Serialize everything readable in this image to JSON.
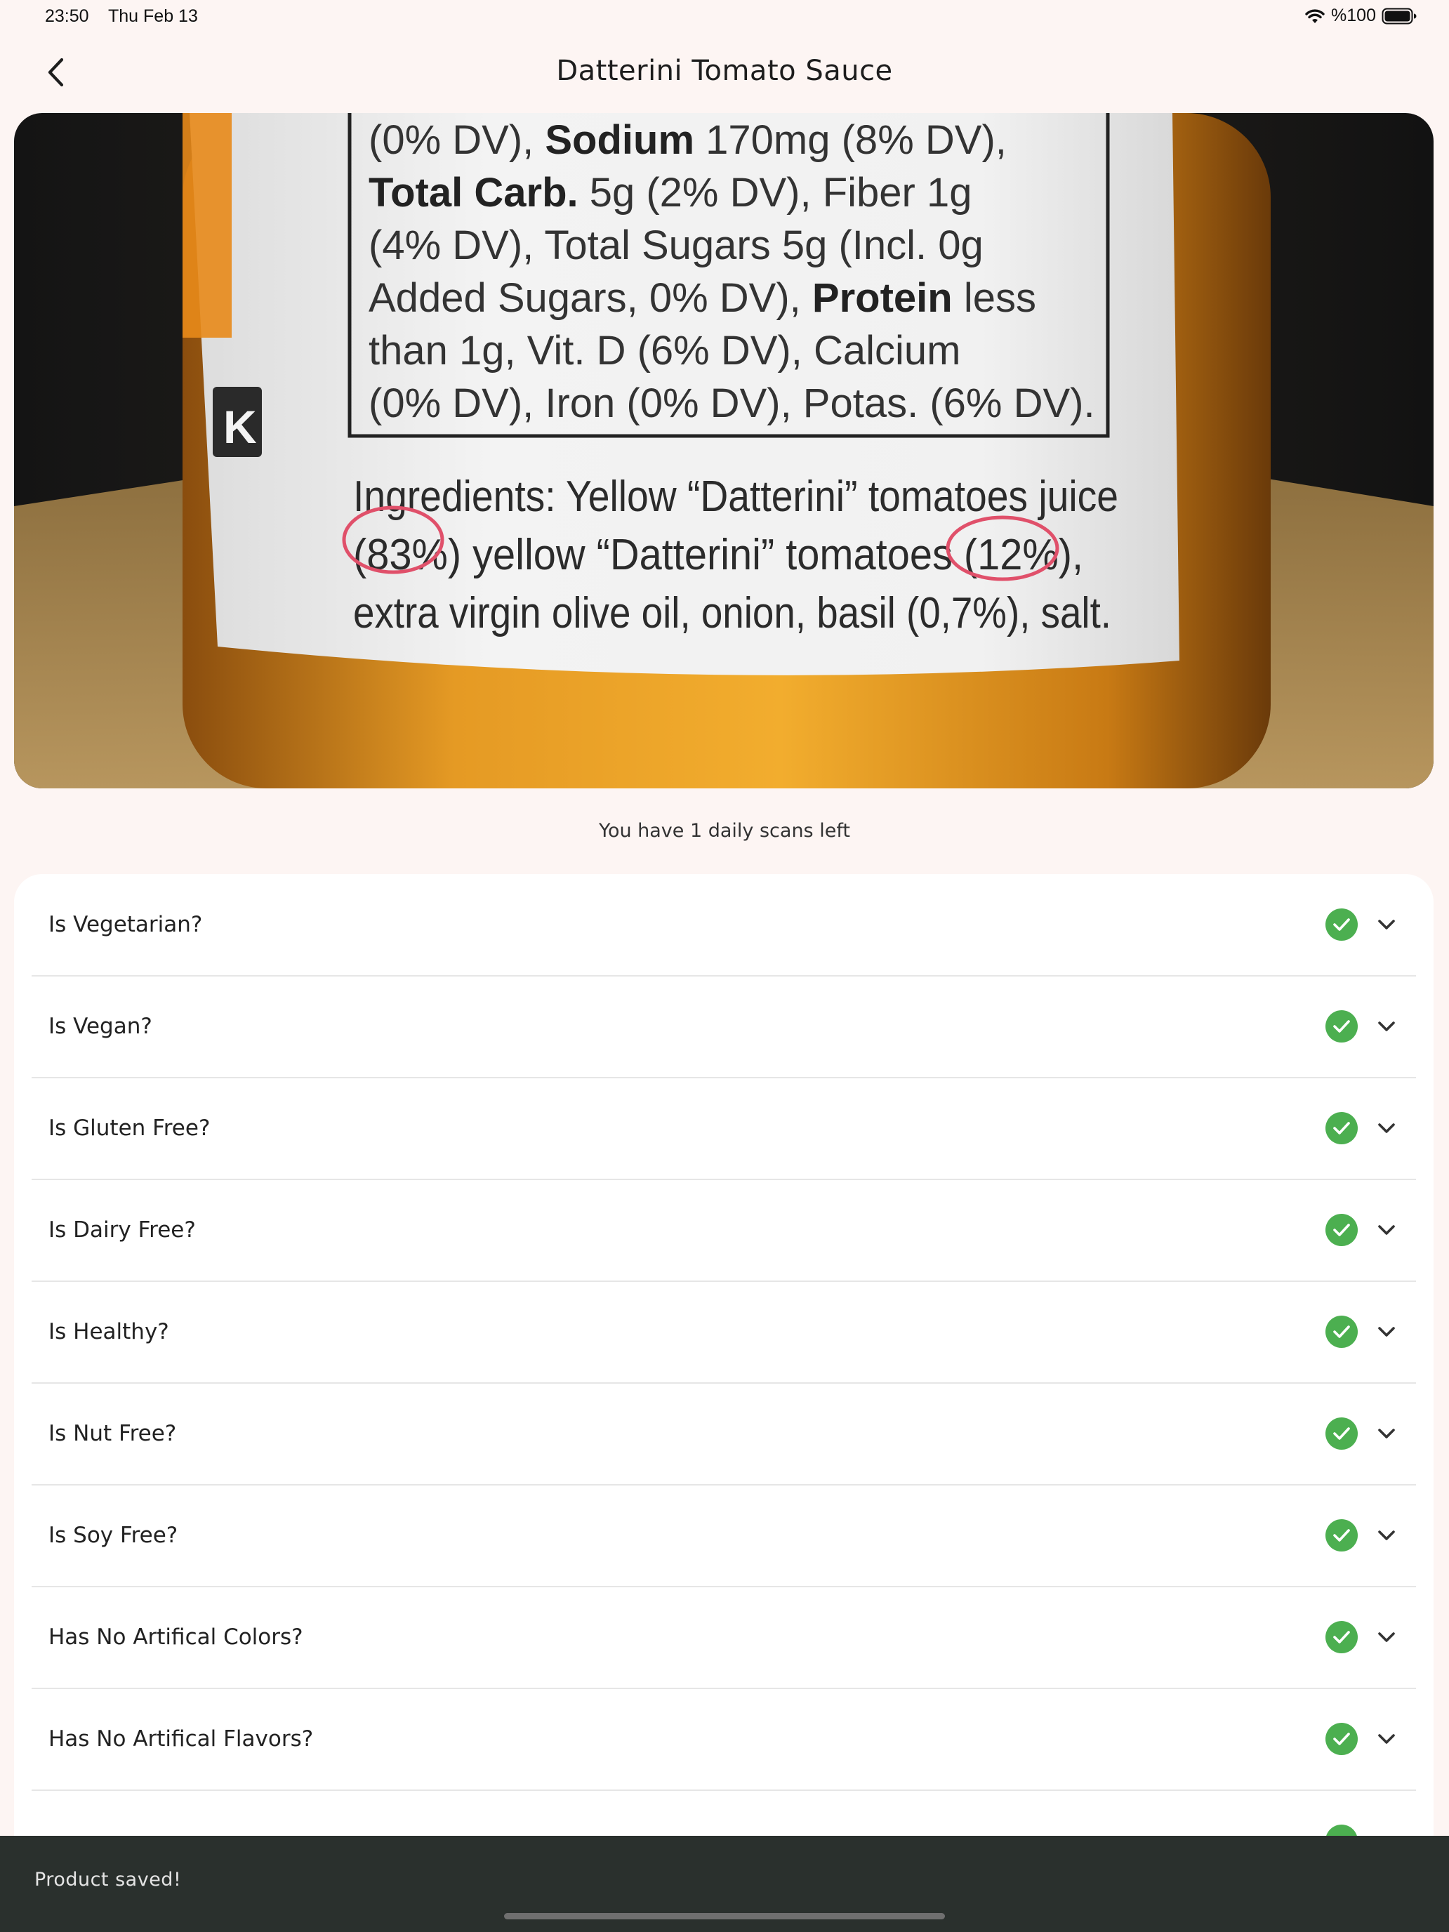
{
  "status_bar": {
    "time": "23:50",
    "date": "Thu Feb 13",
    "battery": "%100"
  },
  "header": {
    "title": "Datterini Tomato Sauce"
  },
  "product_image": {
    "nutrition_lines": [
      [
        "(0% DV), ",
        "Sodium",
        " 170mg (8% DV),"
      ],
      [
        "",
        "Total Carb.",
        " 5g (2% DV), Fiber 1g"
      ],
      [
        "(4% DV), Total Sugars 5g (Incl. 0g",
        "",
        ""
      ],
      [
        "Added Sugars, 0% DV), ",
        "Protein",
        " less"
      ],
      [
        "than 1g, Vit. D (6% DV), Calcium",
        "",
        ""
      ],
      [
        "(0% DV), Iron (0% DV), Potas. (6% DV).",
        "",
        ""
      ]
    ],
    "ingredients_line_1": "Ingredients: Yellow “Datterini” tomatoes juice",
    "ingredients_line_2": "(83%) yellow “Datterini” tomatoes (12%),",
    "ingredients_line_3": "extra virgin olive oil, onion, basil (0,7%), salt.",
    "side_mark": "K"
  },
  "scans_left": "You have 1 daily scans left",
  "checks": [
    {
      "label": "Is Vegetarian?",
      "status": "pass"
    },
    {
      "label": "Is Vegan?",
      "status": "pass"
    },
    {
      "label": "Is Gluten Free?",
      "status": "pass"
    },
    {
      "label": "Is Dairy Free?",
      "status": "pass"
    },
    {
      "label": "Is Healthy?",
      "status": "pass"
    },
    {
      "label": "Is Nut Free?",
      "status": "pass"
    },
    {
      "label": "Is Soy Free?",
      "status": "pass"
    },
    {
      "label": "Has No Artifical Colors?",
      "status": "pass"
    },
    {
      "label": "Has No Artifical Flavors?",
      "status": "pass"
    }
  ],
  "snackbar": {
    "message": "Product saved!"
  },
  "colors": {
    "background": "#fdf5f3",
    "pass_green": "#4caf50",
    "snackbar": "#2a302d"
  }
}
